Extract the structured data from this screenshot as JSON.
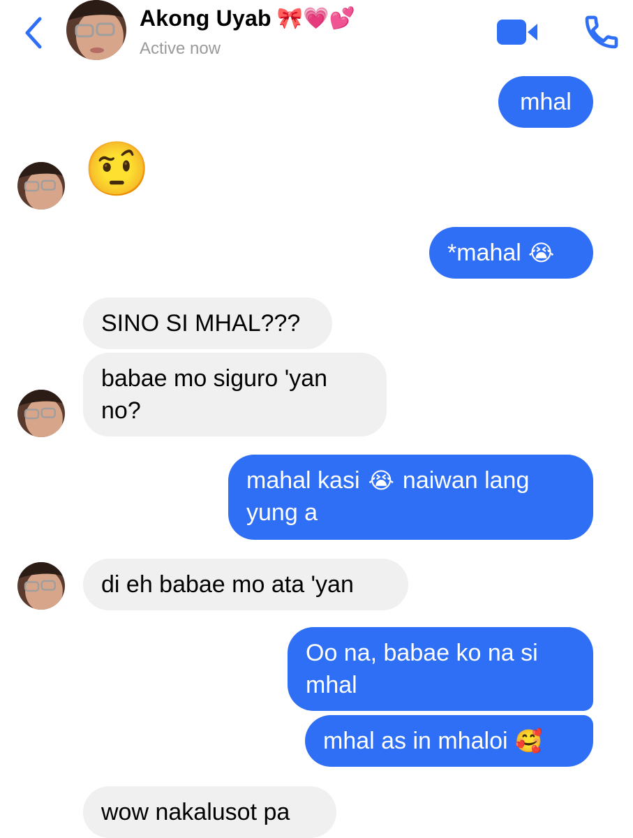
{
  "header": {
    "contact_name": "Akong Uyab",
    "name_emojis": "🎀💗💕",
    "status": "Active now"
  },
  "colors": {
    "accent": "#2f6ff5",
    "incoming_bubble": "#f0f0f0",
    "status_text": "#9a9a9a"
  },
  "icons": {
    "back": "chevron-left-icon",
    "video": "video-camera-icon",
    "call": "phone-icon"
  },
  "messages": [
    {
      "direction": "out",
      "text": "mhal"
    },
    {
      "direction": "in",
      "text": "🤨"
    },
    {
      "direction": "out",
      "text": "*mahal",
      "emoji": "😭"
    },
    {
      "direction": "in",
      "text": "SINO SI MHAL???"
    },
    {
      "direction": "in",
      "line1": "babae mo siguro 'yan",
      "line2": "no?"
    },
    {
      "direction": "out",
      "line1_pre": "mahal kasi",
      "line1_emoji": "😭",
      "line1_post": "naiwan lang",
      "line2": "yung a"
    },
    {
      "direction": "in",
      "text": "di eh babae mo ata 'yan"
    },
    {
      "direction": "out",
      "line1": "Oo na, babae ko na si",
      "line2": "mhal"
    },
    {
      "direction": "out",
      "text": "mhal as in mhaloi",
      "emoji": "🥰"
    },
    {
      "direction": "in",
      "text": "wow nakalusot pa"
    }
  ]
}
